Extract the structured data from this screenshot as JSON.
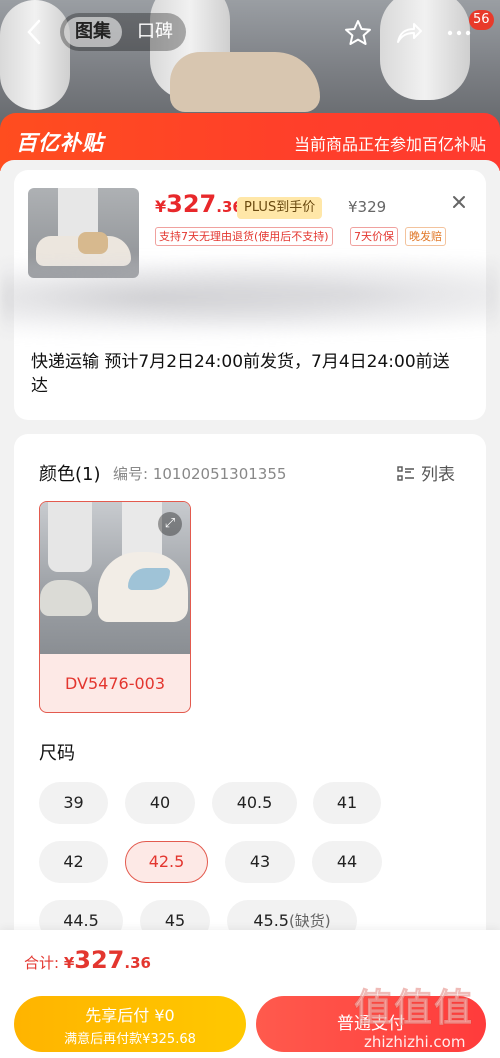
{
  "header": {
    "back_icon": "chevron-left-icon",
    "tabs": [
      {
        "label": "图集",
        "active": true
      },
      {
        "label": "口碑",
        "active": false
      }
    ],
    "badge_count": "56"
  },
  "banner": {
    "logo": "百亿补贴",
    "tip": "当前商品正在参加百亿补贴"
  },
  "product": {
    "price_currency": "¥",
    "price_int": "327",
    "price_dec": ".36",
    "plus_label": "PLUS到手价",
    "original_price": "¥329",
    "tags": [
      "支持7天无理由退货(使用后不支持)",
      "7天价保",
      "晚发赔"
    ],
    "shipping": "快递运输 预计7月2日24:00前发货，7月4日24:00前送达"
  },
  "color_section": {
    "title": "颜色(1)",
    "code": "编号: 10102051301355",
    "list_label": "列表",
    "options": [
      {
        "name": "DV5476-003",
        "selected": true
      }
    ]
  },
  "size_section": {
    "title": "尺码",
    "sizes": [
      "39",
      "40",
      "40.5",
      "41",
      "42",
      "42.5",
      "43",
      "44",
      "44.5",
      "45",
      "45.5"
    ],
    "selected": "42.5",
    "out_of_stock_label": "(缺货)"
  },
  "footer": {
    "total_label": "合计:",
    "total_currency": "¥",
    "total_int": "327",
    "total_dec": ".36",
    "pay_later_line1": "先享后付 ¥0",
    "pay_later_line2": "满意后再付款¥325.68",
    "buy_label": "普通支付",
    "watermark_big": "值",
    "watermark_small": "zhizhizhi.com"
  },
  "colors": {
    "accent": "#e8282b",
    "banner": "#ff4d1f",
    "pay_later": "#ffb400"
  }
}
